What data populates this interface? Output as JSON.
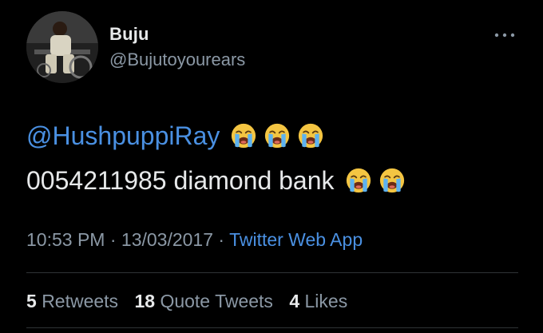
{
  "user": {
    "display_name": "Buju",
    "handle": "@Bujutoyourears"
  },
  "tweet": {
    "mention": "@HushpuppiRay",
    "line1_emojis": [
      "crying-face",
      "crying-face",
      "crying-face"
    ],
    "line2_text": "0054211985 diamond bank",
    "line2_emojis": [
      "crying-face",
      "crying-face"
    ]
  },
  "meta": {
    "time": "10:53 PM",
    "sep1": " · ",
    "date": "13/03/2017",
    "sep2": " · ",
    "source": "Twitter Web App"
  },
  "stats": {
    "retweets_count": "5",
    "retweets_label": "Retweets",
    "quotes_count": "18",
    "quotes_label": "Quote Tweets",
    "likes_count": "4",
    "likes_label": "Likes"
  },
  "colors": {
    "background": "#000000",
    "text": "#e7e9ea",
    "muted": "#8b98a5",
    "link": "#4a90e2",
    "divider": "#2f3336"
  }
}
